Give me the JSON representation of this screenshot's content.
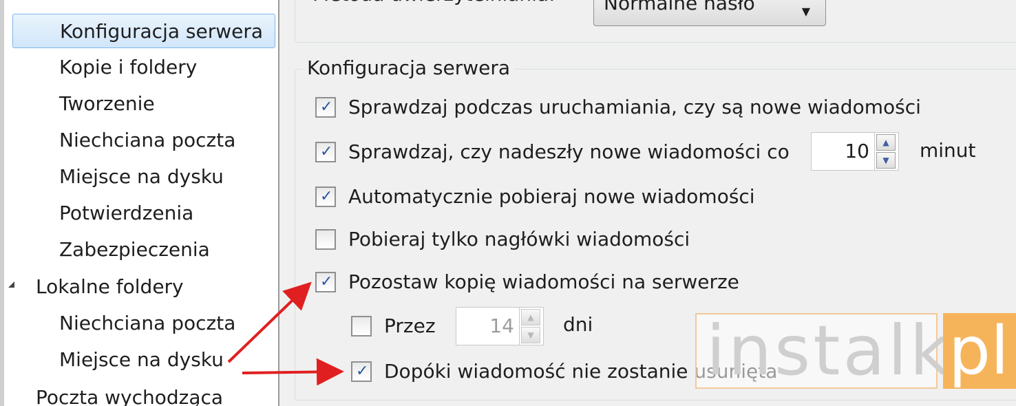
{
  "sidebar": {
    "items": [
      {
        "label": "Konfiguracja serwera",
        "selected": true
      },
      {
        "label": "Kopie i foldery"
      },
      {
        "label": "Tworzenie"
      },
      {
        "label": "Niechciana poczta"
      },
      {
        "label": "Miejsce na dysku"
      },
      {
        "label": "Potwierdzenia"
      },
      {
        "label": "Zabezpieczenia"
      },
      {
        "label": "Lokalne foldery",
        "expanded": true
      },
      {
        "label": "Niechciana poczta"
      },
      {
        "label": "Miejsce na dysku"
      },
      {
        "label": "Poczta wychodząca"
      }
    ]
  },
  "auth": {
    "label": "Metoda uwierzytelniania:",
    "value": "Normalne hasło"
  },
  "server_group": {
    "legend": "Konfiguracja serwera",
    "check_on_startup": {
      "label": "Sprawdzaj podczas uruchamiania, czy są nowe wiadomości",
      "checked": true
    },
    "check_every": {
      "label": "Sprawdzaj, czy nadeszły nowe wiadomości co",
      "checked": true,
      "value": "10",
      "unit": "minut"
    },
    "auto_download": {
      "label": "Automatycznie pobieraj nowe wiadomości",
      "checked": true
    },
    "headers_only": {
      "label": "Pobieraj tylko nagłówki wiadomości",
      "checked": false
    },
    "leave_copy": {
      "label": "Pozostaw kopię wiadomości na serwerze",
      "checked": true
    },
    "keep_for": {
      "label": "Przez",
      "checked": false,
      "value": "14",
      "unit": "dni"
    },
    "until_deleted": {
      "label": "Dopóki wiadomość nie zostanie usunięta",
      "checked": true
    }
  },
  "watermark": {
    "text": "instalki",
    "suffix": "pl"
  },
  "colors": {
    "accent_arrow": "#e02020",
    "selection": "#d1e6fa",
    "panel_bg": "#f0f0f0"
  }
}
